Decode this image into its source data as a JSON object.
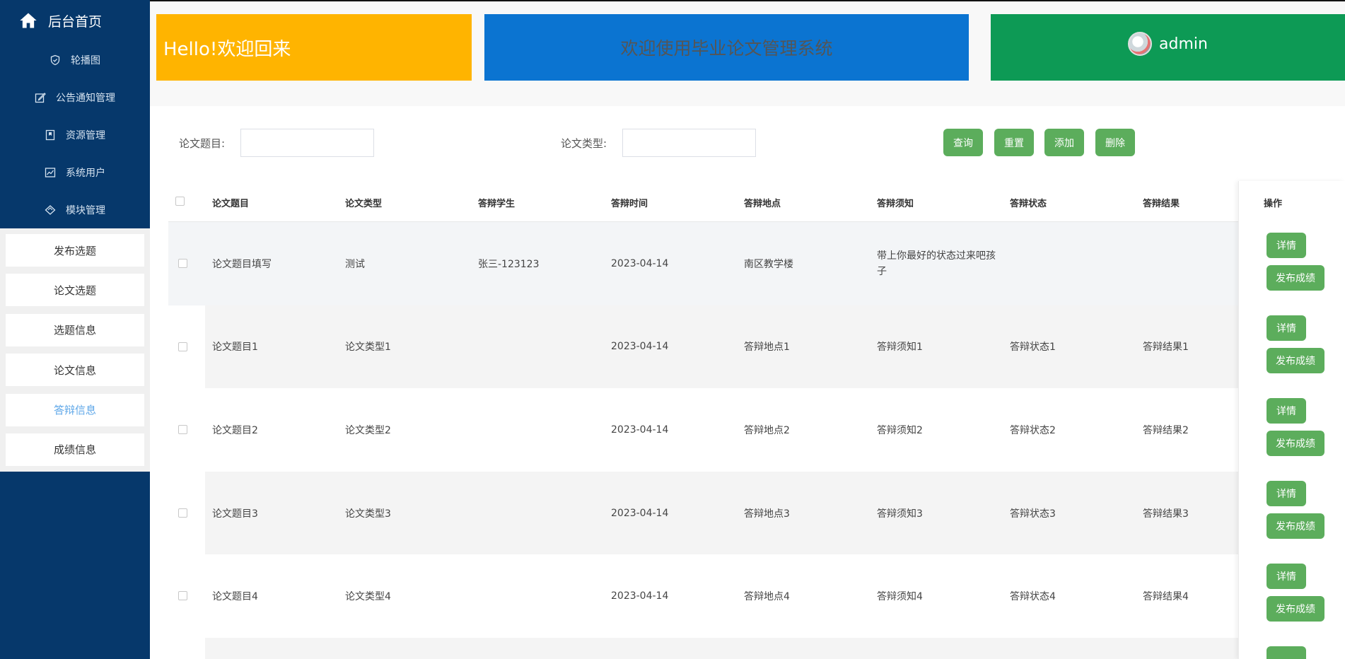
{
  "sidebar": {
    "home_label": "后台首页",
    "nav_items": [
      {
        "label": "轮播图",
        "icon": "shield-icon"
      },
      {
        "label": "公告通知管理",
        "icon": "edit-icon"
      },
      {
        "label": "资源管理",
        "icon": "bookmark-icon"
      },
      {
        "label": "系统用户",
        "icon": "chart-icon"
      },
      {
        "label": "模块管理",
        "icon": "diamond-icon"
      }
    ],
    "sub_items": [
      {
        "label": "发布选题"
      },
      {
        "label": "论文选题"
      },
      {
        "label": "选题信息"
      },
      {
        "label": "论文信息"
      },
      {
        "label": "答辩信息",
        "active": true
      },
      {
        "label": "成绩信息"
      }
    ]
  },
  "cards": {
    "greeting": "Hello!欢迎回来",
    "system_title": "欢迎使用毕业论文管理系统",
    "username": "admin"
  },
  "search": {
    "title_label": "论文题目:",
    "title_value": "",
    "type_label": "论文类型:",
    "type_value": "",
    "buttons": [
      "查询",
      "重置",
      "添加",
      "删除"
    ]
  },
  "table": {
    "headers": [
      "论文题目",
      "论文类型",
      "答辩学生",
      "答辩时间",
      "答辩地点",
      "答辩须知",
      "答辩状态",
      "答辩结果",
      "操作"
    ],
    "rows": [
      {
        "title": "论文题目填写",
        "type": "测试",
        "student": "张三-123123",
        "time": "2023-04-14",
        "place": "南区教学楼",
        "notice": "带上你最好的状态过来吧孩子",
        "status": "",
        "result": ""
      },
      {
        "title": "论文题目1",
        "type": "论文类型1",
        "student": "",
        "time": "2023-04-14",
        "place": "答辩地点1",
        "notice": "答辩须知1",
        "status": "答辩状态1",
        "result": "答辩结果1"
      },
      {
        "title": "论文题目2",
        "type": "论文类型2",
        "student": "",
        "time": "2023-04-14",
        "place": "答辩地点2",
        "notice": "答辩须知2",
        "status": "答辩状态2",
        "result": "答辩结果2"
      },
      {
        "title": "论文题目3",
        "type": "论文类型3",
        "student": "",
        "time": "2023-04-14",
        "place": "答辩地点3",
        "notice": "答辩须知3",
        "status": "答辩状态3",
        "result": "答辩结果3"
      },
      {
        "title": "论文题目4",
        "type": "论文类型4",
        "student": "",
        "time": "2023-04-14",
        "place": "答辩地点4",
        "notice": "答辩须知4",
        "status": "答辩状态4",
        "result": "答辩结果4"
      }
    ],
    "actions": {
      "detail": "详情",
      "publish": "发布成绩"
    }
  },
  "colors": {
    "sidebar_bg": "#06386b",
    "card_yellow": "#ffb400",
    "card_blue": "#0b74d1",
    "card_green": "#0d9a55",
    "button_green": "#5cad5c",
    "active_sub": "#5ea7e8"
  }
}
